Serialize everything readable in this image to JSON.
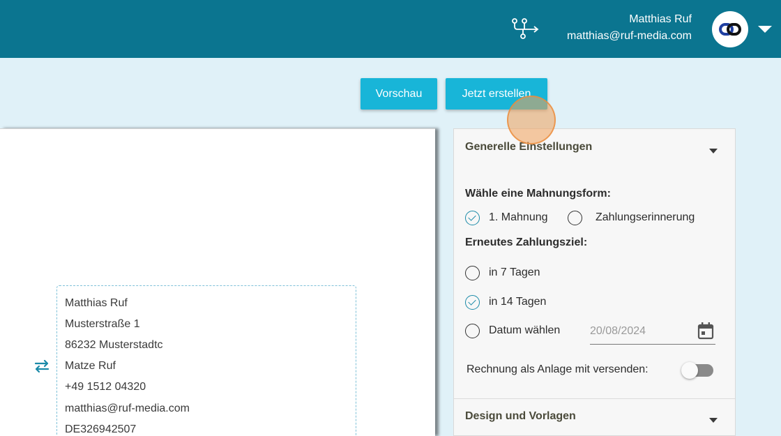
{
  "header": {
    "flow_icon": "workflow-icon",
    "user_name": "Matthias Ruf",
    "user_email": "matthias@ruf-media.com",
    "avatar_icon": "link-icon",
    "menu_icon": "caret-down-icon",
    "background_color": "#0b7590"
  },
  "actions": {
    "preview_label": "Vorschau",
    "create_label": "Jetzt erstellen",
    "button_color": "#18b5d8"
  },
  "document": {
    "swap_icon": "swap-arrows-icon",
    "address_lines": [
      "Matthias Ruf",
      "Musterstraße 1",
      "86232 Musterstadtc",
      "Matze Ruf",
      "+49 1512 04320",
      "matthias@ruf-media.com",
      "DE326942507"
    ]
  },
  "settings": {
    "general_title": "Generelle Einstellungen",
    "reminder_type_label": "Wähle eine Mahnungsform:",
    "reminder_options": [
      {
        "label": "1. Mahnung",
        "checked": true
      },
      {
        "label": "Zahlungserinnerung",
        "checked": false
      }
    ],
    "due_label": "Erneutes Zahlungsziel:",
    "due_options": [
      {
        "label": "in 7 Tagen",
        "checked": false
      },
      {
        "label": "in 14 Tagen",
        "checked": true
      },
      {
        "label": "Datum wählen",
        "checked": false
      }
    ],
    "date_value": "20/08/2024",
    "calendar_icon": "calendar-icon",
    "attach_label": "Rechnung als Anlage mit versenden:",
    "attach_enabled": false,
    "design_title": "Design und Vorlagen"
  }
}
